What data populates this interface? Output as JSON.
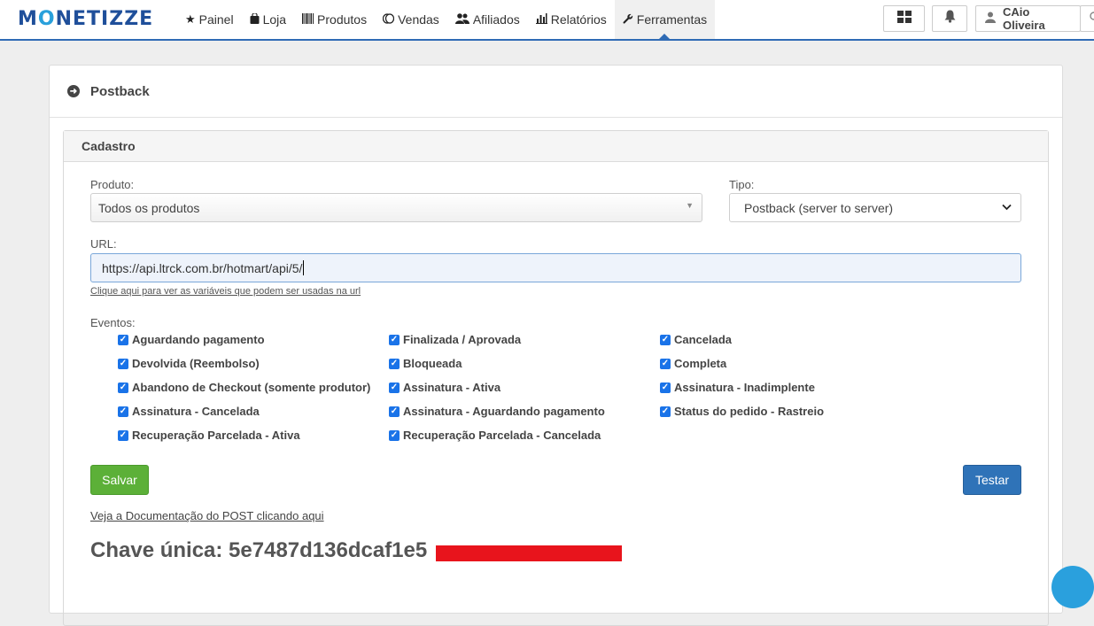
{
  "brand": {
    "logo_text": "MONETIZZE"
  },
  "nav": {
    "items": [
      {
        "label": "Painel",
        "icon": "star-icon"
      },
      {
        "label": "Loja",
        "icon": "shopping-bag-icon"
      },
      {
        "label": "Produtos",
        "icon": "barcode-icon"
      },
      {
        "label": "Vendas",
        "icon": "coins-icon"
      },
      {
        "label": "Afiliados",
        "icon": "users-icon"
      },
      {
        "label": "Relatórios",
        "icon": "bar-chart-icon"
      },
      {
        "label": "Ferramentas",
        "icon": "wrench-icon",
        "active": true
      }
    ]
  },
  "user": {
    "name": "CAio Oliveira"
  },
  "page": {
    "title": "Postback"
  },
  "form": {
    "section_title": "Cadastro",
    "produto_label": "Produto:",
    "produto_value": "Todos os produtos",
    "tipo_label": "Tipo:",
    "tipo_value": "Postback (server to server)",
    "url_label": "URL:",
    "url_value": "https://api.ltrck.com.br/hotmart/api/5/",
    "url_vars_link": "Clique aqui para ver as variáveis que podem ser usadas na url",
    "eventos_label": "Eventos:",
    "events": [
      {
        "label": "Aguardando pagamento",
        "checked": true
      },
      {
        "label": "Finalizada / Aprovada",
        "checked": true
      },
      {
        "label": "Cancelada",
        "checked": true
      },
      {
        "label": "Devolvida (Reembolso)",
        "checked": true
      },
      {
        "label": "Bloqueada",
        "checked": true
      },
      {
        "label": "Completa",
        "checked": true
      },
      {
        "label": "Abandono de Checkout (somente produtor)",
        "checked": true
      },
      {
        "label": "Assinatura - Ativa",
        "checked": true
      },
      {
        "label": "Assinatura - Inadimplente",
        "checked": true
      },
      {
        "label": "Assinatura - Cancelada",
        "checked": true
      },
      {
        "label": "Assinatura - Aguardando pagamento",
        "checked": true
      },
      {
        "label": "Status do pedido - Rastreio",
        "checked": true
      },
      {
        "label": "Recuperação Parcelada - Ativa",
        "checked": true
      },
      {
        "label": "Recuperação Parcelada - Cancelada",
        "checked": true
      }
    ],
    "save_label": "Salvar",
    "test_label": "Testar",
    "doc_link": "Veja a Documentação do POST clicando aqui",
    "key_text": "Chave única: 5e7487d136dcaf1e5"
  },
  "colors": {
    "brand_blue": "#1f4f9a",
    "accent_blue": "#2f6bb5",
    "save_green": "#5cb038",
    "test_blue": "#2f73b8",
    "redaction": "#e8141c"
  }
}
